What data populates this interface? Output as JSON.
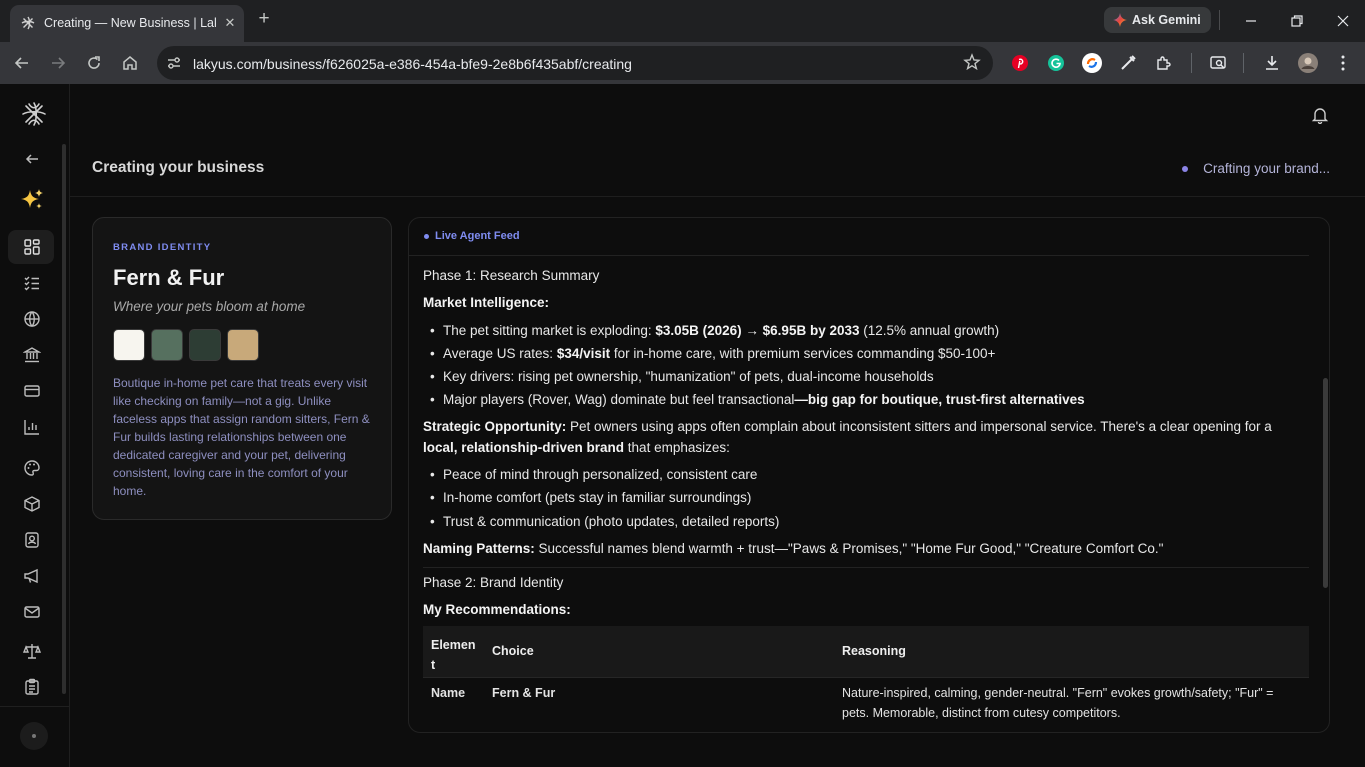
{
  "browser": {
    "tab_title": "Creating — New Business | Lakyus",
    "tab_close": "✕",
    "new_tab": "+",
    "ask_gemini": "Ask Gemini",
    "url": "lakyus.com/business/f626025a-e386-454a-bfe9-2e8b6f435abf/creating",
    "extensions": [
      "pinterest-icon",
      "grammarly-icon",
      "sync-icon",
      "pen-icon",
      "puzzle-icon"
    ]
  },
  "header": {
    "title": "Creating your business",
    "status": "Crafting your brand..."
  },
  "brand": {
    "kicker": "BRAND IDENTITY",
    "name": "Fern & Fur",
    "tagline": "Where your pets bloom at home",
    "swatches": [
      "#f7f5ef",
      "#56705f",
      "#2d3d34",
      "#c8a97a"
    ],
    "description": "Boutique in-home pet care that treats every visit like checking on family—not a gig. Unlike faceless apps that assign random sitters, Fern & Fur builds lasting relationships between one dedicated caregiver and your pet, delivering consistent, loving care in the comfort of your home."
  },
  "feed": {
    "label": "Live Agent Feed",
    "phase1": "Phase 1: Research Summary",
    "market_heading": "Market Intelligence:",
    "market_bullets": [
      {
        "pre": "The pet sitting market is exploding: ",
        "bold": "$3.05B (2026) → $6.95B by 2033",
        "post": " (12.5% annual growth)"
      },
      {
        "pre": "Average US rates: ",
        "bold": "$34/visit",
        "post": " for in-home care, with premium services commanding $50-100+"
      },
      {
        "pre": "Key drivers: rising pet ownership, \"humanization\" of pets, dual-income households",
        "bold": "",
        "post": ""
      },
      {
        "pre": "Major players (Rover, Wag) dominate but feel transactional",
        "bold": "—big gap for boutique, trust-first alternatives",
        "post": ""
      }
    ],
    "strategic_label": "Strategic Opportunity:",
    "strategic_text1": " Pet owners using apps often complain about inconsistent sitters and impersonal service. There's a clear opening for a",
    "strategic_bold2": "local, relationship-driven brand",
    "strategic_text2": " that emphasizes:",
    "strategic_bullets": [
      "Peace of mind through personalized, consistent care",
      "In-home comfort (pets stay in familiar surroundings)",
      "Trust & communication (photo updates, detailed reports)"
    ],
    "naming_label": "Naming Patterns:",
    "naming_text": " Successful names blend warmth + trust—\"Paws & Promises,\" \"Home Fur Good,\" \"Creature Comfort Co.\"",
    "phase2": "Phase 2: Brand Identity",
    "recs_heading": "My Recommendations:",
    "table": {
      "headers": [
        "Element",
        "Choice",
        "Reasoning"
      ],
      "header_element_line1": "Elemen",
      "header_element_line2": "t",
      "rows": [
        {
          "element": "Name",
          "choice": "Fern & Fur",
          "reasoning_line1": "Nature-inspired, calming, gender-neutral. \"Fern\" evokes growth/safety; \"Fur\" =",
          "reasoning_line2": "pets. Memorable, distinct from cutesy competitors."
        }
      ]
    }
  }
}
